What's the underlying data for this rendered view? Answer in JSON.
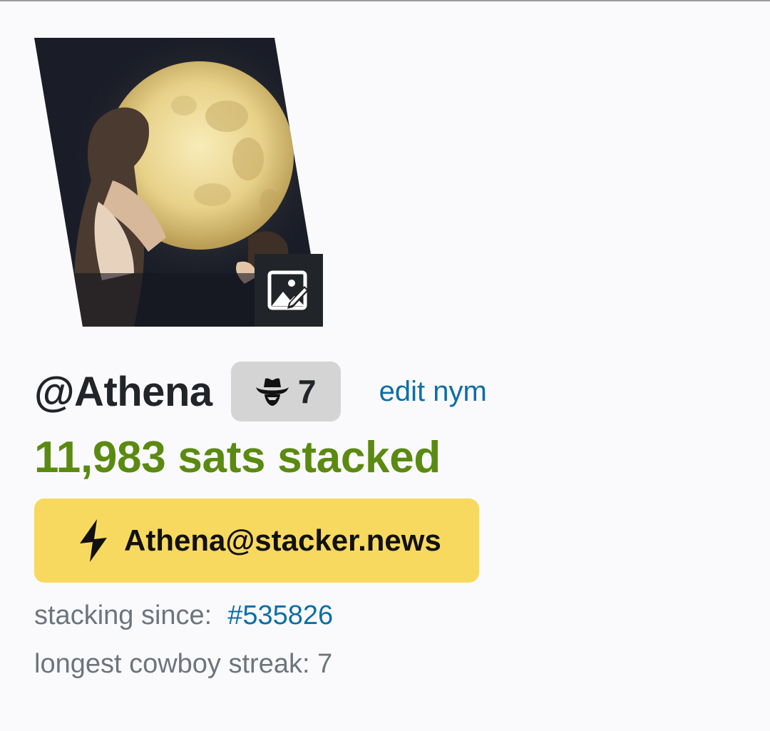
{
  "profile": {
    "nym": "@Athena",
    "streak_count": "7",
    "edit_nym_label": "edit nym",
    "sats_stacked": "11,983 sats stacked",
    "lightning_address": "Athena@stacker.news",
    "stacking_since_label": "stacking since:",
    "stacking_since_link": "#535826",
    "longest_streak": "longest cowboy streak: 7"
  },
  "icons": {
    "edit_photo": "image-edit-icon",
    "streak": "cowboy-hat-icon",
    "lightning": "lightning-bolt-icon"
  },
  "colors": {
    "accent_link": "#0d6ea6",
    "sats_green": "#5b8a10",
    "lightning_yellow": "#f8d95f",
    "badge_gray": "#d4d4d4"
  }
}
